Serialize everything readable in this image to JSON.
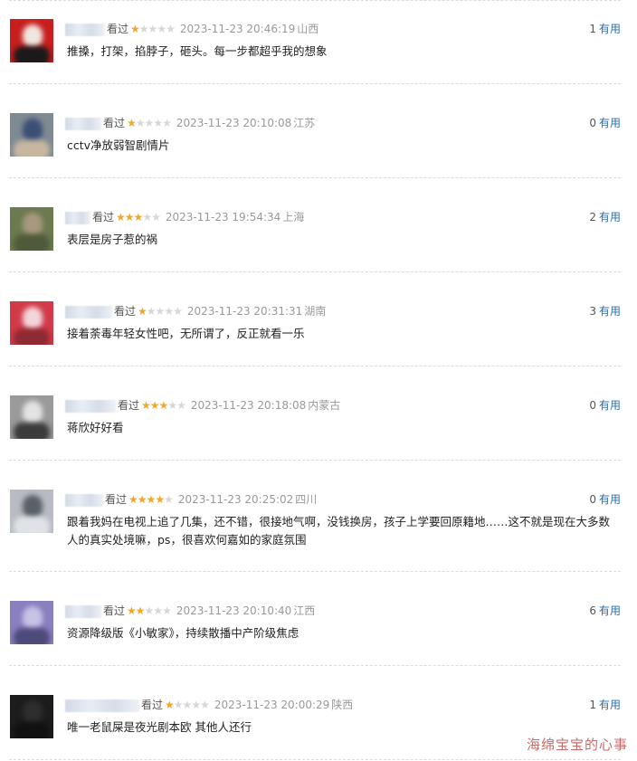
{
  "comments": [
    {
      "watched": "看过",
      "rating": 1,
      "time": "2023-11-23 20:46:19",
      "location": "山西",
      "useful_count": "1",
      "useful_label": "有用",
      "text": "推搡，打架，掐脖子，砸头。每一步都超乎我的想象",
      "avatar_colors": [
        "#c81e1e",
        "#f0e7e0",
        "#1a1a1a"
      ]
    },
    {
      "watched": "看过",
      "rating": 1,
      "time": "2023-11-23 20:10:08",
      "location": "江苏",
      "useful_count": "0",
      "useful_label": "有用",
      "text": "cctv净放弱智剧情片",
      "avatar_colors": [
        "#7f8a93",
        "#3c4e75",
        "#c7b7a0"
      ]
    },
    {
      "watched": "看过",
      "rating": 3,
      "time": "2023-11-23 19:54:34",
      "location": "上海",
      "useful_count": "2",
      "useful_label": "有用",
      "text": "表层是房子惹的祸",
      "avatar_colors": [
        "#6c7a4f",
        "#a89880",
        "#4f5a3a"
      ]
    },
    {
      "watched": "看过",
      "rating": 1,
      "time": "2023-11-23 20:31:31",
      "location": "湖南",
      "useful_count": "3",
      "useful_label": "有用",
      "text": "接着荼毒年轻女性吧，无所谓了，反正就看一乐",
      "avatar_colors": [
        "#d23a4a",
        "#f2d6d9",
        "#8e2a33"
      ]
    },
    {
      "watched": "看过",
      "rating": 3,
      "time": "2023-11-23 20:18:08",
      "location": "内蒙古",
      "useful_count": "0",
      "useful_label": "有用",
      "text": "蒋欣好好看",
      "avatar_colors": [
        "#9a9a9a",
        "#e3e3e3",
        "#3b3b3b"
      ]
    },
    {
      "watched": "看过",
      "rating": 4,
      "time": "2023-11-23 20:25:02",
      "location": "四川",
      "useful_count": "0",
      "useful_label": "有用",
      "text": "跟着我妈在电视上追了几集，还不错，很接地气啊，没钱换房，孩子上学要回原籍地……这不就是现在大多数人的真实处境嘛，ps，很喜欢何嘉如的家庭氛围",
      "avatar_colors": [
        "#b8bcc2",
        "#5a6068",
        "#dfe2e6"
      ]
    },
    {
      "watched": "看过",
      "rating": 2,
      "time": "2023-11-23 20:10:40",
      "location": "江西",
      "useful_count": "6",
      "useful_label": "有用",
      "text": "资源降级版《小敏家》，持续散播中产阶级焦虑",
      "avatar_colors": [
        "#8a7fbf",
        "#c7c3e6",
        "#4d4a7a"
      ]
    },
    {
      "watched": "看过",
      "rating": 1,
      "time": "2023-11-23 20:00:29",
      "location": "陕西",
      "useful_count": "1",
      "useful_label": "有用",
      "text": "唯一老鼠屎是夜光剧本欧 其他人还行",
      "avatar_colors": [
        "#1c1c1c",
        "#2e2e2e",
        "#111111"
      ]
    }
  ],
  "watermark": "海绵宝宝的心事"
}
